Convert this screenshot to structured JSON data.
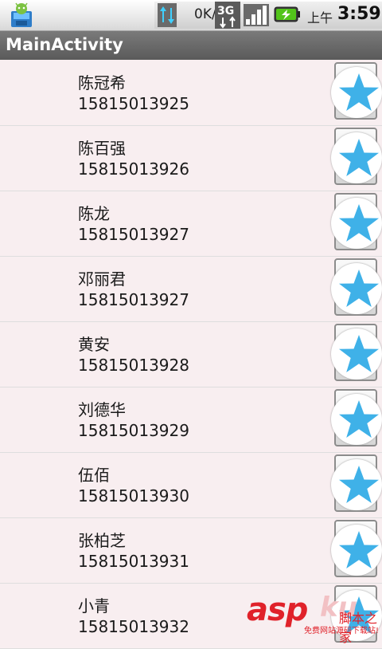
{
  "status_bar": {
    "app_icon": "android-robot-icon",
    "data_arrows_icon": "up-down-arrows-icon",
    "network_speed": "0K/s",
    "network_type": "3G",
    "signal_icon": "signal-bars-icon",
    "battery_icon": "battery-charging-icon",
    "ampm": "上午",
    "time": "3:59"
  },
  "title_bar": {
    "title": "MainActivity"
  },
  "contacts": [
    {
      "name": "陈冠希",
      "phone": "15815013925"
    },
    {
      "name": "陈百强",
      "phone": "15815013926"
    },
    {
      "name": "陈龙",
      "phone": "15815013927"
    },
    {
      "name": "邓丽君",
      "phone": "15815013927"
    },
    {
      "name": "黄安",
      "phone": "15815013928"
    },
    {
      "name": "刘德华",
      "phone": "15815013929"
    },
    {
      "name": "伍佰",
      "phone": "15815013930"
    },
    {
      "name": "张柏芝",
      "phone": "15815013931"
    },
    {
      "name": "小青",
      "phone": "15815013932"
    }
  ],
  "star_icon": "star-icon",
  "colors": {
    "star": "#3fb1e8",
    "accent_red": "#e0222a"
  },
  "watermark": {
    "brand": "asp",
    "brand_suffix": "ku",
    "site_name": "脚本之家",
    "tagline": "免费网站源码下载站!"
  }
}
